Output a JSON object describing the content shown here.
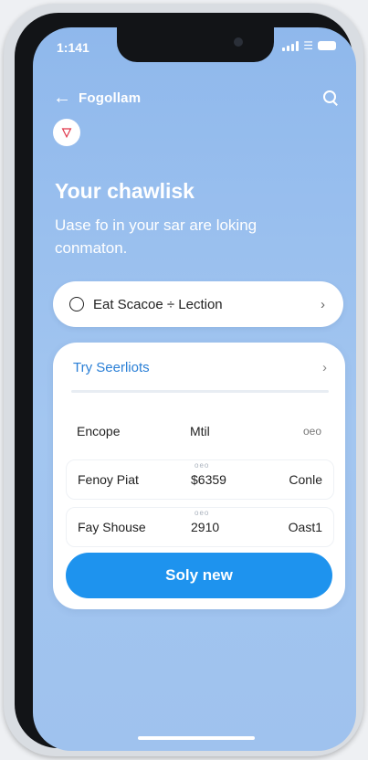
{
  "status_bar": {
    "time": "1:141"
  },
  "topbar": {
    "title": "Fogollam"
  },
  "hero": {
    "headline": "Your chawlisk",
    "subtext": "Uase fo in your sar are loking conmaton."
  },
  "selector": {
    "label": "Eat Scacoe ÷ Lection"
  },
  "card": {
    "title": "Try Seerliots",
    "rows": [
      {
        "c1": "Encope",
        "c2": "Mtil",
        "c3": "oeo",
        "tiny": ""
      },
      {
        "c1": "Fenoy Piat",
        "c2": "$6359",
        "c3": "Conle",
        "tiny": "oeo"
      },
      {
        "c1": "Fay Shouse",
        "c2": "2910",
        "c3": "Oast1",
        "tiny": "oeo"
      }
    ],
    "cta_label": "Soly new"
  },
  "colors": {
    "accent": "#1e93ee",
    "background": "#9fc2ee",
    "badge": "#e0354a"
  },
  "icons": [
    "back-arrow-icon",
    "search-icon",
    "badge-icon",
    "radio-icon",
    "chevron-right-icon"
  ]
}
